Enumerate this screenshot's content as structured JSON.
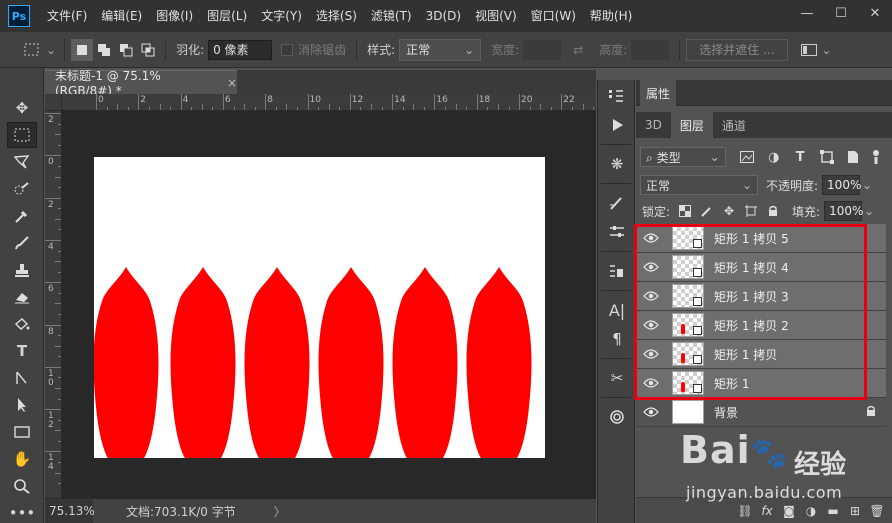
{
  "app": {
    "logo": "Ps"
  },
  "menu": [
    "文件(F)",
    "编辑(E)",
    "图像(I)",
    "图层(L)",
    "文字(Y)",
    "选择(S)",
    "滤镜(T)",
    "3D(D)",
    "视图(V)",
    "窗口(W)",
    "帮助(H)"
  ],
  "window_controls": {
    "minimize": "—",
    "maximize": "☐",
    "close": "✕"
  },
  "options": {
    "feather_label": "羽化:",
    "feather_value": "0 像素",
    "antialias_label": "消除锯齿",
    "style_label": "样式:",
    "style_value": "正常",
    "width_label": "宽度:",
    "height_label": "高度:",
    "select_mask_button": "选择并遮住 ..."
  },
  "document": {
    "tab_title": "未标题-1 @ 75.1%(RGB/8#) *",
    "close": "×",
    "zoom": "75.13%",
    "doc_info": "文档:703.1K/0 字节",
    "status_arrow": "〉"
  },
  "ruler": {
    "h_labels": [
      "0",
      "2",
      "4",
      "6",
      "8",
      "10",
      "12",
      "14",
      "16",
      "18",
      "20",
      "22"
    ],
    "v_labels": [
      "2",
      "0",
      "2",
      "4",
      "6",
      "8",
      "1\n0",
      "1\n2",
      "1\n4"
    ]
  },
  "panels": {
    "properties_tab": "属性",
    "tabs": [
      "3D",
      "图层",
      "通道"
    ],
    "active_tab": "图层",
    "filter_kind": "类型",
    "blend_mode": "正常",
    "opacity_label": "不透明度:",
    "opacity_value": "100%",
    "lock_label": "锁定:",
    "fill_label": "填充:",
    "fill_value": "100%"
  },
  "layers": [
    {
      "name": "矩形 1 拷贝 5",
      "selected": true,
      "marks": 0
    },
    {
      "name": "矩形 1 拷贝 4",
      "selected": true,
      "marks": 0
    },
    {
      "name": "矩形 1 拷贝 3",
      "selected": true,
      "marks": 0
    },
    {
      "name": "矩形 1 拷贝 2",
      "selected": true,
      "marks": 1
    },
    {
      "name": "矩形 1 拷贝",
      "selected": true,
      "marks": 1
    },
    {
      "name": "矩形 1",
      "selected": true,
      "marks": 1
    },
    {
      "name": "背景",
      "selected": false,
      "marks": 0,
      "locked": true
    }
  ],
  "colors": {
    "petal": "#ff0000",
    "highlight": "#e60012",
    "canvas": "#ffffff"
  },
  "watermark": {
    "brand": "Bai",
    "brand_cn": "经验",
    "url": "jingyan.baidu.com"
  }
}
